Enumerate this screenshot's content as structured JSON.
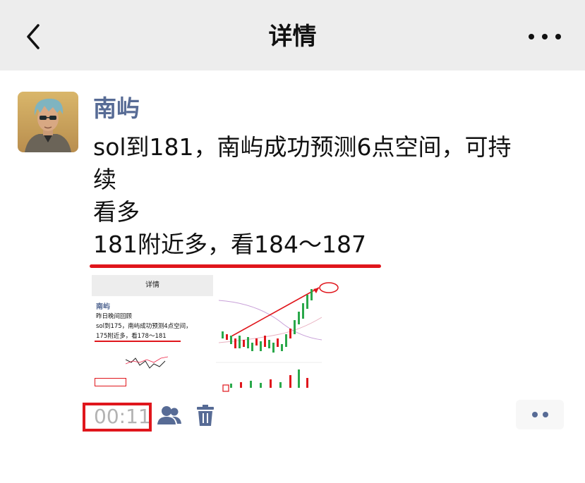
{
  "nav": {
    "title": "详情",
    "back_icon": "chevron-left-icon",
    "more_icon": "more-dots-icon"
  },
  "post": {
    "author": "南屿",
    "lines": [
      "sol到181，南屿成功预测6点空间，可持",
      "续",
      "看多",
      "181附近多，看184～187"
    ],
    "time": "00:11"
  },
  "thumbnail_screenshot": {
    "title": "详情",
    "author": "南屿",
    "lines": [
      "昨日晚间回顾",
      "sol到175，南屿成功预测4点空间，",
      "175附近多，看178～181"
    ]
  },
  "colors": {
    "accent_red": "#e0161c",
    "author_blue": "#576b95",
    "nav_bg": "#ededed"
  }
}
